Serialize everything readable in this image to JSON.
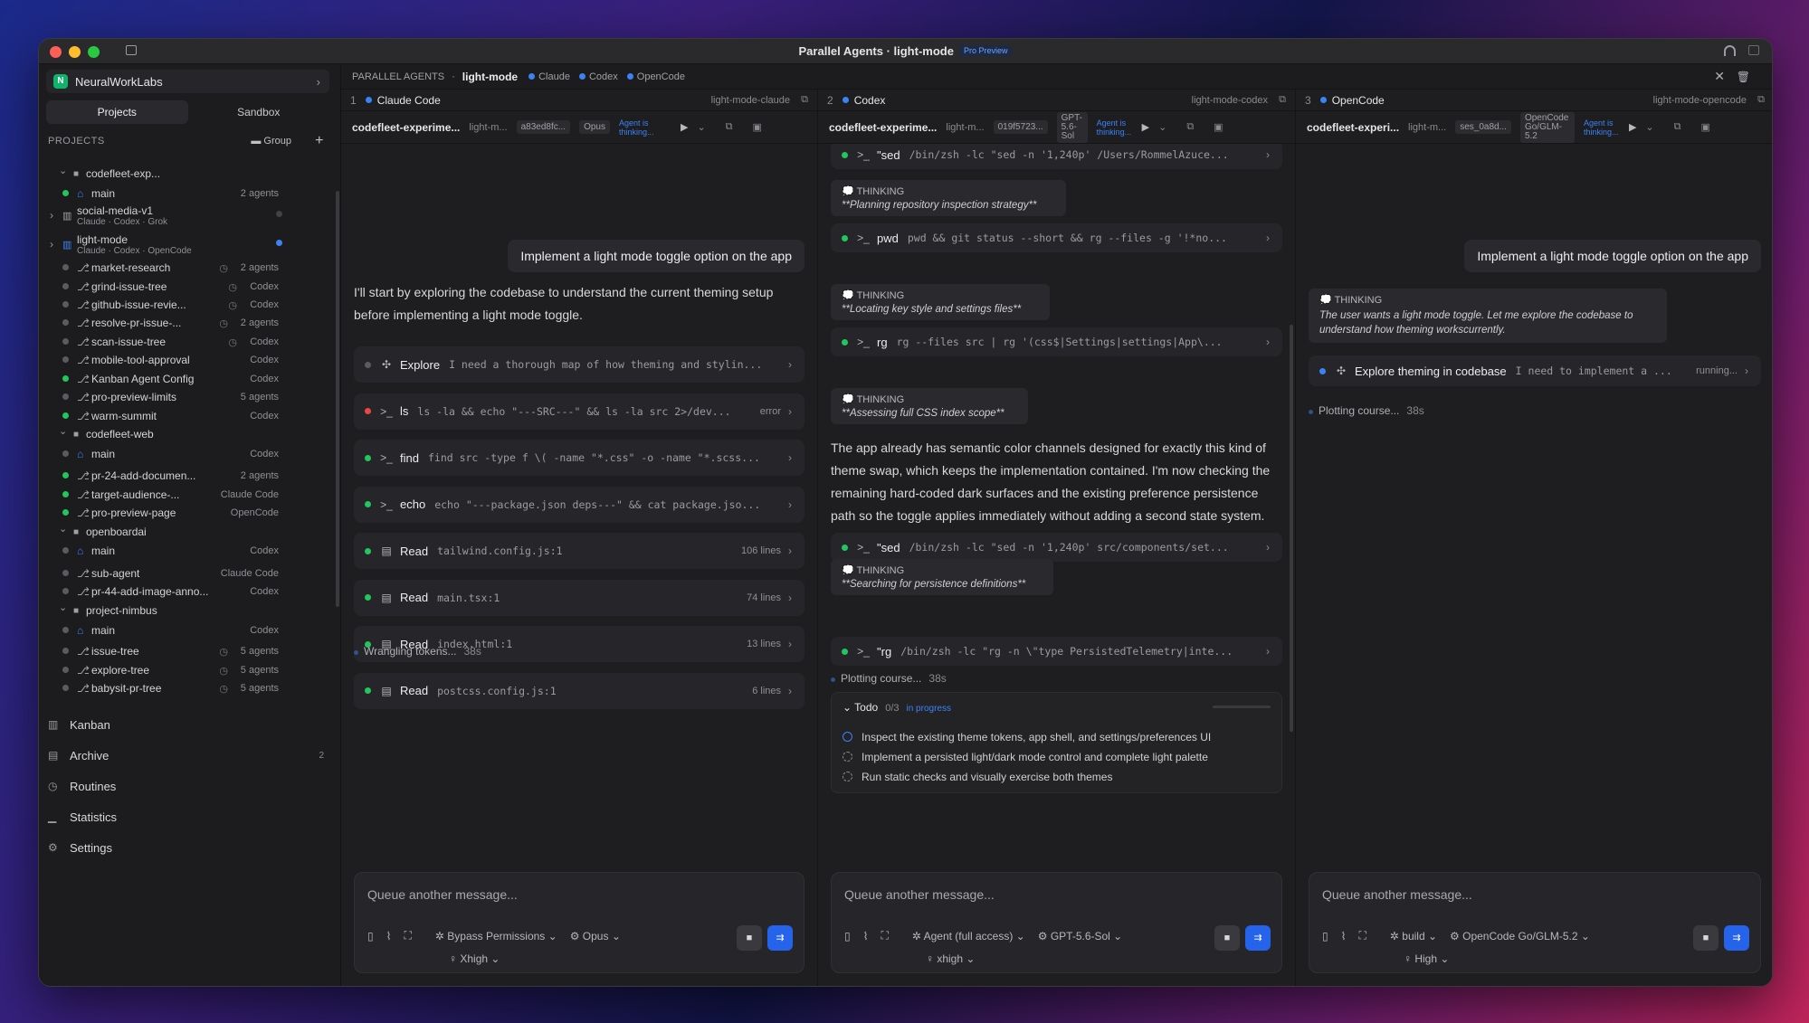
{
  "window": {
    "title": "Parallel Agents · light-mode",
    "badge": "Pro Preview"
  },
  "sidebar": {
    "org": "NeuralWorkLabs",
    "tabs": [
      "Projects",
      "Sandbox"
    ],
    "projects_label": "PROJECTS",
    "group_label": "Group",
    "tree": [
      {
        "label": "codefleet-exp...",
        "meta": "",
        "type": "folder"
      },
      {
        "label": "main",
        "meta": "2 agents",
        "type": "home",
        "status": "g"
      },
      {
        "label": "social-media-v1",
        "sub": "Claude · Codex · Grok",
        "meta": "",
        "type": "board",
        "status": "gr"
      },
      {
        "label": "light-mode",
        "sub": "Claude · Codex · OpenCode",
        "meta": "",
        "type": "board",
        "status": "b"
      },
      {
        "label": "market-research",
        "meta": "2 agents",
        "type": "branch",
        "status": "gr"
      },
      {
        "label": "grind-issue-tree",
        "meta": "Codex",
        "type": "branch",
        "status": "gr"
      },
      {
        "label": "github-issue-revie...",
        "meta": "Codex",
        "type": "branch",
        "status": "gr"
      },
      {
        "label": "resolve-pr-issue-...",
        "meta": "2 agents",
        "type": "branch",
        "status": "gr"
      },
      {
        "label": "scan-issue-tree",
        "meta": "Codex",
        "type": "branch",
        "status": "gr"
      },
      {
        "label": "mobile-tool-approval",
        "meta": "Codex",
        "type": "branch",
        "status": "gr"
      },
      {
        "label": "Kanban Agent Config",
        "meta": "Codex",
        "type": "branch",
        "status": "g"
      },
      {
        "label": "pro-preview-limits",
        "meta": "5 agents",
        "type": "branch",
        "status": "gr"
      },
      {
        "label": "warm-summit",
        "meta": "Codex",
        "type": "branch",
        "status": "g"
      },
      {
        "label": "codefleet-web",
        "meta": "",
        "type": "folder"
      },
      {
        "label": "main",
        "meta": "Codex",
        "type": "home",
        "status": "gr"
      },
      {
        "label": "pr-24-add-documen...",
        "meta": "2 agents",
        "type": "branch",
        "status": "g"
      },
      {
        "label": "target-audience-...",
        "meta": "Claude Code",
        "type": "branch",
        "status": "g"
      },
      {
        "label": "pro-preview-page",
        "meta": "OpenCode",
        "type": "branch",
        "status": "g"
      },
      {
        "label": "openboardai",
        "meta": "",
        "type": "folder"
      },
      {
        "label": "main",
        "meta": "Codex",
        "type": "home",
        "status": "gr"
      },
      {
        "label": "sub-agent",
        "meta": "Claude Code",
        "type": "branch",
        "status": "gr"
      },
      {
        "label": "pr-44-add-image-anno...",
        "meta": "Codex",
        "type": "branch",
        "status": "gr"
      },
      {
        "label": "project-nimbus",
        "meta": "",
        "type": "folder"
      },
      {
        "label": "main",
        "meta": "Codex",
        "type": "home",
        "status": "gr"
      },
      {
        "label": "issue-tree",
        "meta": "5 agents",
        "type": "branch",
        "status": "gr"
      },
      {
        "label": "explore-tree",
        "meta": "5 agents",
        "type": "branch",
        "status": "gr"
      },
      {
        "label": "babysit-pr-tree",
        "meta": "5 agents",
        "type": "branch",
        "status": "gr"
      }
    ],
    "nav": [
      {
        "label": "Kanban",
        "count": ""
      },
      {
        "label": "Archive",
        "count": "2"
      },
      {
        "label": "Routines",
        "count": ""
      },
      {
        "label": "Statistics",
        "count": ""
      },
      {
        "label": "Settings",
        "count": ""
      }
    ]
  },
  "topbar": {
    "section": "PARALLEL AGENTS",
    "workspace": "light-mode",
    "agents": [
      "Claude",
      "Codex",
      "OpenCode"
    ]
  },
  "panes": [
    {
      "num": "1",
      "name": "Claude Code",
      "branch": "light-mode-claude",
      "project": "codefleet-experime...",
      "branch_short": "light-m...",
      "commit": "a83ed8fc...",
      "model_chip": "Opus",
      "state": "Agent is thinking...",
      "user_msg": "Implement a light mode toggle option on the app",
      "para": "I'll start by exploring the codebase to understand the current theming setup before implementing a light mode toggle.",
      "tools": [
        {
          "name": "Explore",
          "cmd": "I need a thorough map of how theming and stylin...",
          "result": "",
          "status": "gr"
        },
        {
          "name": "ls",
          "cmd": "ls -la && echo \"---SRC---\" && ls -la src 2>/dev...",
          "result": "error",
          "status": "r"
        },
        {
          "name": "find",
          "cmd": "find src -type f \\( -name \"*.css\" -o -name \"*.scss...",
          "result": "",
          "status": "g"
        },
        {
          "name": "echo",
          "cmd": "echo \"---package.json deps---\" && cat package.jso...",
          "result": "",
          "status": "g"
        },
        {
          "name": "Read",
          "cmd": "tailwind.config.js:1",
          "result": "106 lines",
          "status": "g"
        },
        {
          "name": "Read",
          "cmd": "main.tsx:1",
          "result": "74 lines",
          "status": "g"
        },
        {
          "name": "Read",
          "cmd": "index.html:1",
          "result": "13 lines",
          "status": "g"
        },
        {
          "name": "Read",
          "cmd": "postcss.config.js:1",
          "result": "6 lines",
          "status": "g"
        }
      ],
      "status_text": "Wrangling tokens...",
      "status_time": "38s",
      "composer": {
        "placeholder": "Queue another message...",
        "mode": "Bypass Permissions",
        "model": "Opus",
        "effort": "Xhigh"
      }
    },
    {
      "num": "2",
      "name": "Codex",
      "branch": "light-mode-codex",
      "project": "codefleet-experime...",
      "branch_short": "light-m...",
      "commit": "019f5723...",
      "model_chip": "GPT-5.6-Sol",
      "state": "Agent is thinking...",
      "tools_top": [
        {
          "name": "\"sed",
          "cmd": "/bin/zsh -lc \"sed -n '1,240p' /Users/RommelAzuce..."
        },
        {
          "name": "pwd",
          "cmd": "pwd && git status --short && rg --files -g '!*no..."
        },
        {
          "name": "rg",
          "cmd": "rg --files src | rg '(css$|Settings|settings|App\\..."
        }
      ],
      "thinking": [
        "**Planning repository inspection strategy**",
        "**Locating key style and settings files**",
        "**Assessing full CSS index scope**",
        "**Searching for persistence definitions**"
      ],
      "think_label": "THINKING",
      "para": "The app already has semantic color channels designed for exactly this kind of theme swap, which keeps the implementation contained. I'm now checking the remaining hard-coded dark surfaces and the existing preference persistence path so the toggle applies immediately without adding a second state system.",
      "tools_bottom": [
        {
          "name": "\"sed",
          "cmd": "/bin/zsh -lc \"sed -n '1,240p' src/components/set..."
        },
        {
          "name": "\"rg",
          "cmd": "/bin/zsh -lc \"rg -n \\\"type PersistedTelemetry|inte..."
        }
      ],
      "status_text": "Plotting course...",
      "status_time": "38s",
      "todo": {
        "title": "Todo",
        "count": "0/3",
        "state": "in progress",
        "items": [
          "Inspect the existing theme tokens, app shell, and settings/preferences UI",
          "Implement a persisted light/dark mode control and complete light palette",
          "Run static checks and visually exercise both themes"
        ]
      },
      "composer": {
        "placeholder": "Queue another message...",
        "mode": "Agent (full access)",
        "model": "GPT-5.6-Sol",
        "effort": "xhigh"
      }
    },
    {
      "num": "3",
      "name": "OpenCode",
      "branch": "light-mode-opencode",
      "project": "codefleet-experi...",
      "branch_short": "light-m...",
      "commit": "ses_0a8d...",
      "model_chip": "OpenCode Go/GLM-5.2",
      "state": "Agent is thinking...",
      "user_msg": "Implement a light mode toggle option on the app",
      "think_label": "THINKING",
      "thinking": "The user wants a light mode toggle. Let me explore the codebase to understand how theming workscurrently.",
      "tool": {
        "name": "Explore theming in codebase",
        "cmd": "I need to implement a ...",
        "result": "running..."
      },
      "status_text": "Plotting course...",
      "status_time": "38s",
      "composer": {
        "placeholder": "Queue another message...",
        "mode": "build",
        "model": "OpenCode Go/GLM-5.2",
        "effort": "High"
      }
    }
  ]
}
